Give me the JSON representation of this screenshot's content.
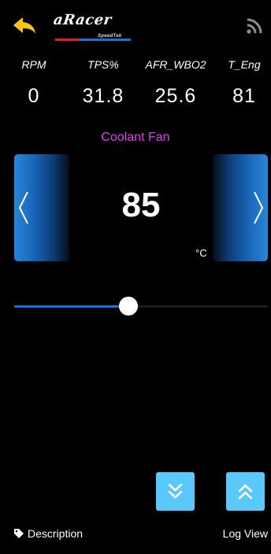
{
  "header": {
    "logo_text": "aRacer",
    "logo_subtext": "SpeedTek",
    "back_icon": "back-arrow-icon",
    "signal_icon": "rss-icon"
  },
  "metrics": [
    {
      "label": "RPM",
      "value": "0"
    },
    {
      "label": "TPS%",
      "value": "31.8"
    },
    {
      "label": "AFR_WBO2",
      "value": "25.6"
    },
    {
      "label": "T_Eng",
      "value": "81"
    }
  ],
  "parameter": {
    "title": "Coolant Fan",
    "value": "85",
    "unit": "°C",
    "slider_fraction": 0.45
  },
  "controls": {
    "down_icon": "double-chevron-down-icon",
    "up_icon": "double-chevron-up-icon"
  },
  "footer": {
    "description_label": "Description",
    "log_view_label": "Log View"
  },
  "colors": {
    "background": "#000000",
    "title_accent": "#e143ea",
    "button_blue": "#5ac8fa",
    "slider_fill": "#1a6ede",
    "back_arrow": "#f5c518"
  }
}
